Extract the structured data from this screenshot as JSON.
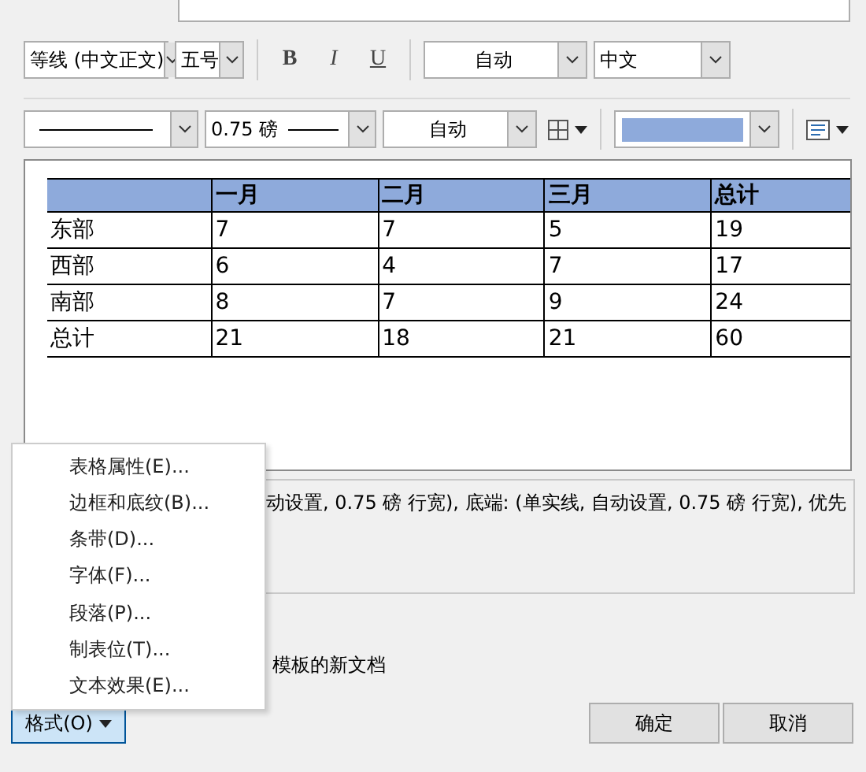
{
  "font_toolbar": {
    "font": "等线 (中文正文)",
    "size": "五号",
    "bold": "B",
    "italic": "I",
    "underline": "U",
    "font_color_setting": "自动",
    "language": "中文"
  },
  "border_toolbar": {
    "weight": "0.75 磅",
    "border_color_setting": "自动"
  },
  "preview_table": {
    "columns": [
      "一月",
      "二月",
      "三月",
      "总计"
    ],
    "rows": [
      {
        "label": "东部",
        "cells": [
          "7",
          "7",
          "5",
          "19"
        ]
      },
      {
        "label": "西部",
        "cells": [
          "6",
          "4",
          "7",
          "17"
        ]
      },
      {
        "label": "南部",
        "cells": [
          "8",
          "7",
          "9",
          "24"
        ]
      },
      {
        "label": "总计",
        "cells": [
          "21",
          "18",
          "21",
          "60"
        ]
      }
    ]
  },
  "description": "动设置,  0.75 磅 行宽), 底端: (单实线, 自动设置,  0.75 磅 行宽), 优先",
  "option_text": "模板的新文档",
  "format_menu": {
    "items": [
      "表格属性(E)...",
      "边框和底纹(B)...",
      "条带(D)...",
      "字体(F)...",
      "段落(P)...",
      "制表位(T)...",
      "文本效果(E)..."
    ]
  },
  "format_button": "格式(O)",
  "buttons": [
    "确定",
    "取消"
  ]
}
